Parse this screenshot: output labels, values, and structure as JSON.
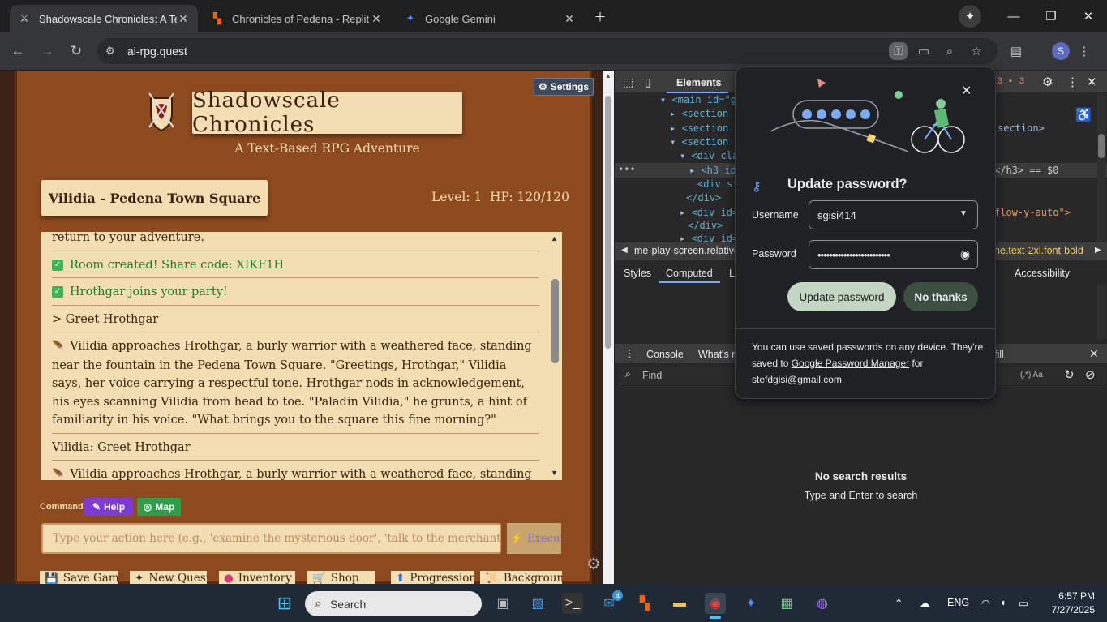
{
  "browser": {
    "tabs": [
      {
        "title": "Shadowscale Chronicles: A Text",
        "active": true
      },
      {
        "title": "Chronicles of Pedena - Replit",
        "active": false
      },
      {
        "title": "Google Gemini",
        "active": false
      }
    ],
    "url": "ai-rpg.quest"
  },
  "game": {
    "settings_label": "Settings",
    "title": "Shadowscale Chronicles",
    "subtitle": "A Text-Based RPG Adventure",
    "location": "Vilidia - Pedena Town Square",
    "level": "Level: 1",
    "hp": "HP: 120/120",
    "log": {
      "partial_top": "return to your adventure.",
      "entries": [
        {
          "type": "system",
          "text": "Room created! Share code: XIKF1H"
        },
        {
          "type": "system",
          "text": "Hrothgar joins your party!"
        },
        {
          "type": "command",
          "text": "> Greet Hrothgar"
        },
        {
          "type": "narration",
          "text": "Vilidia approaches Hrothgar, a burly warrior with a weathered face, standing near the fountain in the Pedena Town Square. \"Greetings, Hrothgar,\" Vilidia says, her voice carrying a respectful tone. Hrothgar nods in acknowledgement, his eyes scanning Vilidia from head to toe. \"Paladin Vilidia,\" he grunts, a hint of familiarity in his voice. \"What brings you to the square this fine morning?\""
        },
        {
          "type": "command",
          "text": "Vilidia: Greet Hrothgar"
        },
        {
          "type": "narration",
          "text": "Vilidia approaches Hrothgar, a burly warrior with a weathered face, standing near the fountain in the Pedena Town Square."
        }
      ]
    },
    "command_label": "Command:",
    "help_label": "Help",
    "map_label": "Map",
    "action_placeholder": "Type your action here (e.g., 'examine the mysterious door', 'talk to the merchant', 'cast fir",
    "execute_label": "Execute",
    "bottom_buttons": [
      "Save Game",
      "New Quest",
      "Inventory",
      "Shop",
      "Progression",
      "Background"
    ]
  },
  "devtools": {
    "tab_elements": "Elements",
    "counts": [
      "3",
      "3"
    ],
    "dom_lines": [
      "<main id=\"gam",
      "<section id",
      "<section id",
      "<section id",
      "<div clas",
      "<h3 id=",
      "<div st",
      "</div>",
      "<div id=\"",
      "</div>",
      "<div id=\""
    ],
    "dom_right": [
      "section>",
      "</h3> == $0",
      "flow-y-auto\">"
    ],
    "breadcrumb_left": "me-play-screen.relative",
    "breadcrumb_right": "ne.text-2xl.font-bold",
    "subtabs": [
      "Styles",
      "Computed",
      "L",
      "Accessibility"
    ],
    "drawer_tabs": [
      "Console",
      "What's n"
    ],
    "drawer_right": "fill",
    "find_placeholder": "Find",
    "find_opts": "(.*)  Aa",
    "no_results": "No search results",
    "hint": "Type and Enter to search"
  },
  "password_popup": {
    "title": "Update password?",
    "username_label": "Username",
    "username_value": "sgisi414",
    "password_label": "Password",
    "password_value": "•••••••••••••••••••••••••",
    "update_button": "Update password",
    "no_button": "No thanks",
    "footer_1": "You can use saved passwords on any device. They're saved to ",
    "footer_link": "Google Password Manager",
    "footer_2": " for",
    "footer_email": "stefdgisi@gmail.com."
  },
  "taskbar": {
    "search_label": "Search",
    "badge": "4",
    "lang": "ENG",
    "time": "6:57 PM",
    "date": "7/27/2025"
  }
}
